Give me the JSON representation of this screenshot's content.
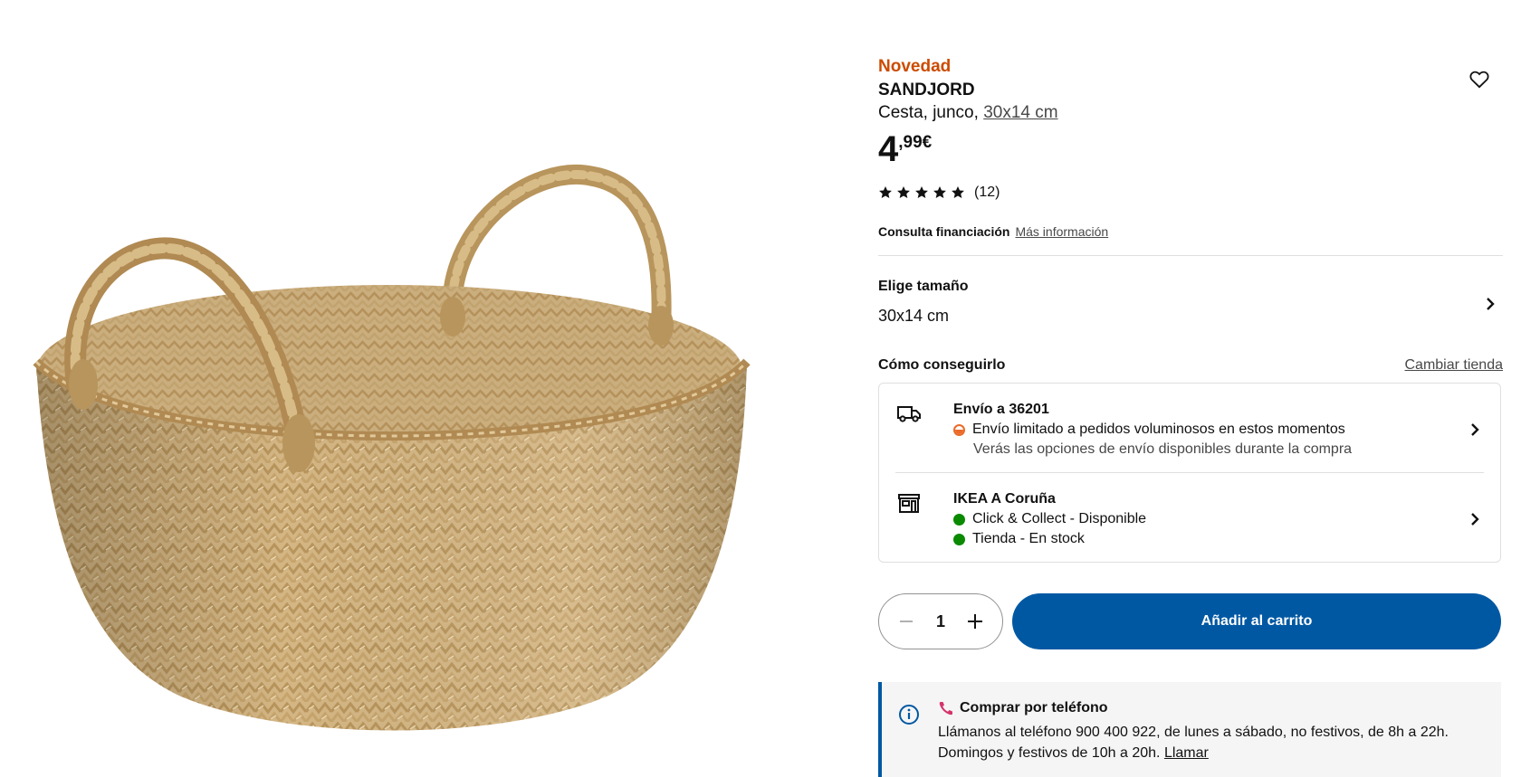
{
  "product": {
    "badge": "Novedad",
    "name": "SANDJORD",
    "description": "Cesta, junco,",
    "size_link": "30x14 cm",
    "price_int": "4",
    "price_dec": ",99€",
    "rating": 5,
    "rating_count": "(12)",
    "image_icon": "wicker-basket-image"
  },
  "finance": {
    "label": "Consulta financiación",
    "link": "Más información"
  },
  "size": {
    "label": "Elige tamaño",
    "value": "30x14 cm"
  },
  "get_it": {
    "title": "Cómo conseguirlo",
    "change_store": "Cambiar tienda",
    "delivery": {
      "icon": "truck-icon",
      "title": "Envío a 36201",
      "status": "Envío limitado a pedidos voluminosos en estos momentos",
      "note": "Verás las opciones de envío disponibles durante la compra",
      "status_color": "#ea6a28"
    },
    "store": {
      "icon": "store-icon",
      "title": "IKEA A Coruña",
      "click_collect": "Click & Collect - Disponible",
      "in_store": "Tienda - En stock",
      "status_color": "#0a8a00"
    }
  },
  "purchase": {
    "quantity": "1",
    "add_to_cart": "Añadir al carrito",
    "accent": "#0058a3"
  },
  "phone": {
    "title": "Comprar por teléfono",
    "text": "Llámanos al teléfono 900 400 922, de lunes a sábado, no festivos, de 8h a 22h. Domingos y festivos de 10h a 20h.",
    "link": "Llamar"
  }
}
